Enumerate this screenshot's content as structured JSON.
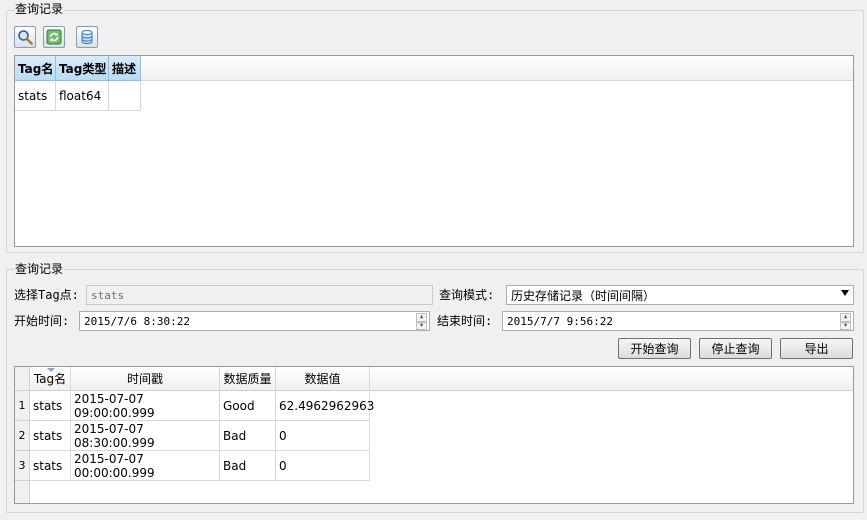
{
  "top_group": {
    "title": "查询记录",
    "toolbar": [
      "search-icon",
      "refresh-icon",
      "database-icon"
    ],
    "table": {
      "headers": [
        "Tag名",
        "Tag类型",
        "描述"
      ],
      "rows": [
        [
          "stats",
          "float64",
          ""
        ]
      ]
    }
  },
  "bottom_group": {
    "title": "查询记录",
    "select_tag_label": "选择Tag点:",
    "select_tag_value": "stats",
    "query_mode_label": "查询模式:",
    "query_mode_value": "历史存储记录（时间间隔）",
    "start_time_label": "开始时间:",
    "start_time_value": "2015/7/6 8:30:22",
    "end_time_label": "结束时间:",
    "end_time_value": "2015/7/7 9:56:22",
    "buttons": {
      "start": "开始查询",
      "stop": "停止查询",
      "export": "导出"
    },
    "results": {
      "headers": [
        "Tag名",
        "时间戳",
        "数据质量",
        "数据值"
      ],
      "rows": [
        {
          "num": "1",
          "tag": "stats",
          "time": "2015-07-07 09:00:00.999",
          "quality": "Good",
          "value": "62.4962962963"
        },
        {
          "num": "2",
          "tag": "stats",
          "time": "2015-07-07 08:30:00.999",
          "quality": "Bad",
          "value": "0"
        },
        {
          "num": "3",
          "tag": "stats",
          "time": "2015-07-07 00:00:00.999",
          "quality": "Bad",
          "value": "0"
        }
      ]
    }
  }
}
